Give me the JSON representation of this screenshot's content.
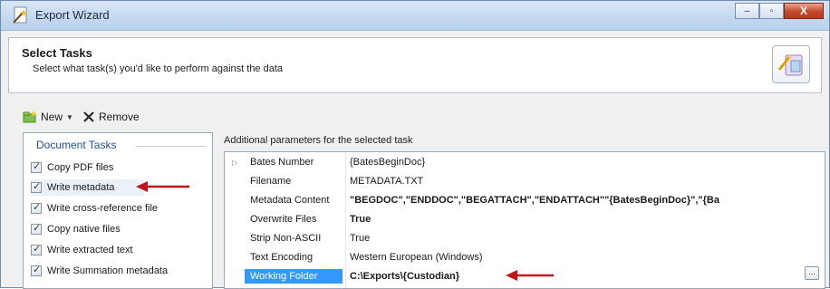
{
  "window": {
    "title": "Export Wizard",
    "controls": {
      "minimize": "‒",
      "maximize": "▫",
      "close": "X"
    }
  },
  "header": {
    "title": "Select Tasks",
    "subtitle": "Select what task(s) you'd like to perform against the data"
  },
  "toolbar": {
    "new_label": "New",
    "remove_label": "Remove"
  },
  "tasks": {
    "group_label": "Document Tasks",
    "items": [
      {
        "label": "Copy PDF files",
        "checked": true
      },
      {
        "label": "Write metadata",
        "checked": true,
        "selected": true
      },
      {
        "label": "Write cross-reference file",
        "checked": true
      },
      {
        "label": "Copy native files",
        "checked": true
      },
      {
        "label": "Write extracted text",
        "checked": true
      },
      {
        "label": "Write Summation metadata",
        "checked": true
      }
    ]
  },
  "params": {
    "label": "Additional parameters for the selected task",
    "rows": [
      {
        "name": "Bates Number",
        "value": "{BatesBeginDoc}",
        "bold": false,
        "expandable": true
      },
      {
        "name": "Filename",
        "value": "METADATA.TXT",
        "bold": false
      },
      {
        "name": "Metadata Content",
        "value": "\"BEGDOC\",\"ENDDOC\",\"BEGATTACH\",\"ENDATTACH\"\"{BatesBeginDoc}\",\"{Ba",
        "bold": true
      },
      {
        "name": "Overwrite Files",
        "value": "True",
        "bold": true
      },
      {
        "name": "Strip Non-ASCII",
        "value": "True",
        "bold": false
      },
      {
        "name": "Text Encoding",
        "value": "Western European (Windows)",
        "bold": false
      },
      {
        "name": "Working Folder",
        "value": "C:\\Exports\\{Custodian}",
        "bold": true,
        "selected": true
      }
    ],
    "ellipsis_label": "..."
  },
  "colors": {
    "annotation_arrow": "#c0161b",
    "selection": "#3399ff",
    "group_header": "#1f4e9a"
  },
  "icons": {
    "title": "wizard-wand-icon",
    "header": "wizard-tasks-icon",
    "new": "new-folder-icon",
    "remove": "remove-x-icon"
  }
}
